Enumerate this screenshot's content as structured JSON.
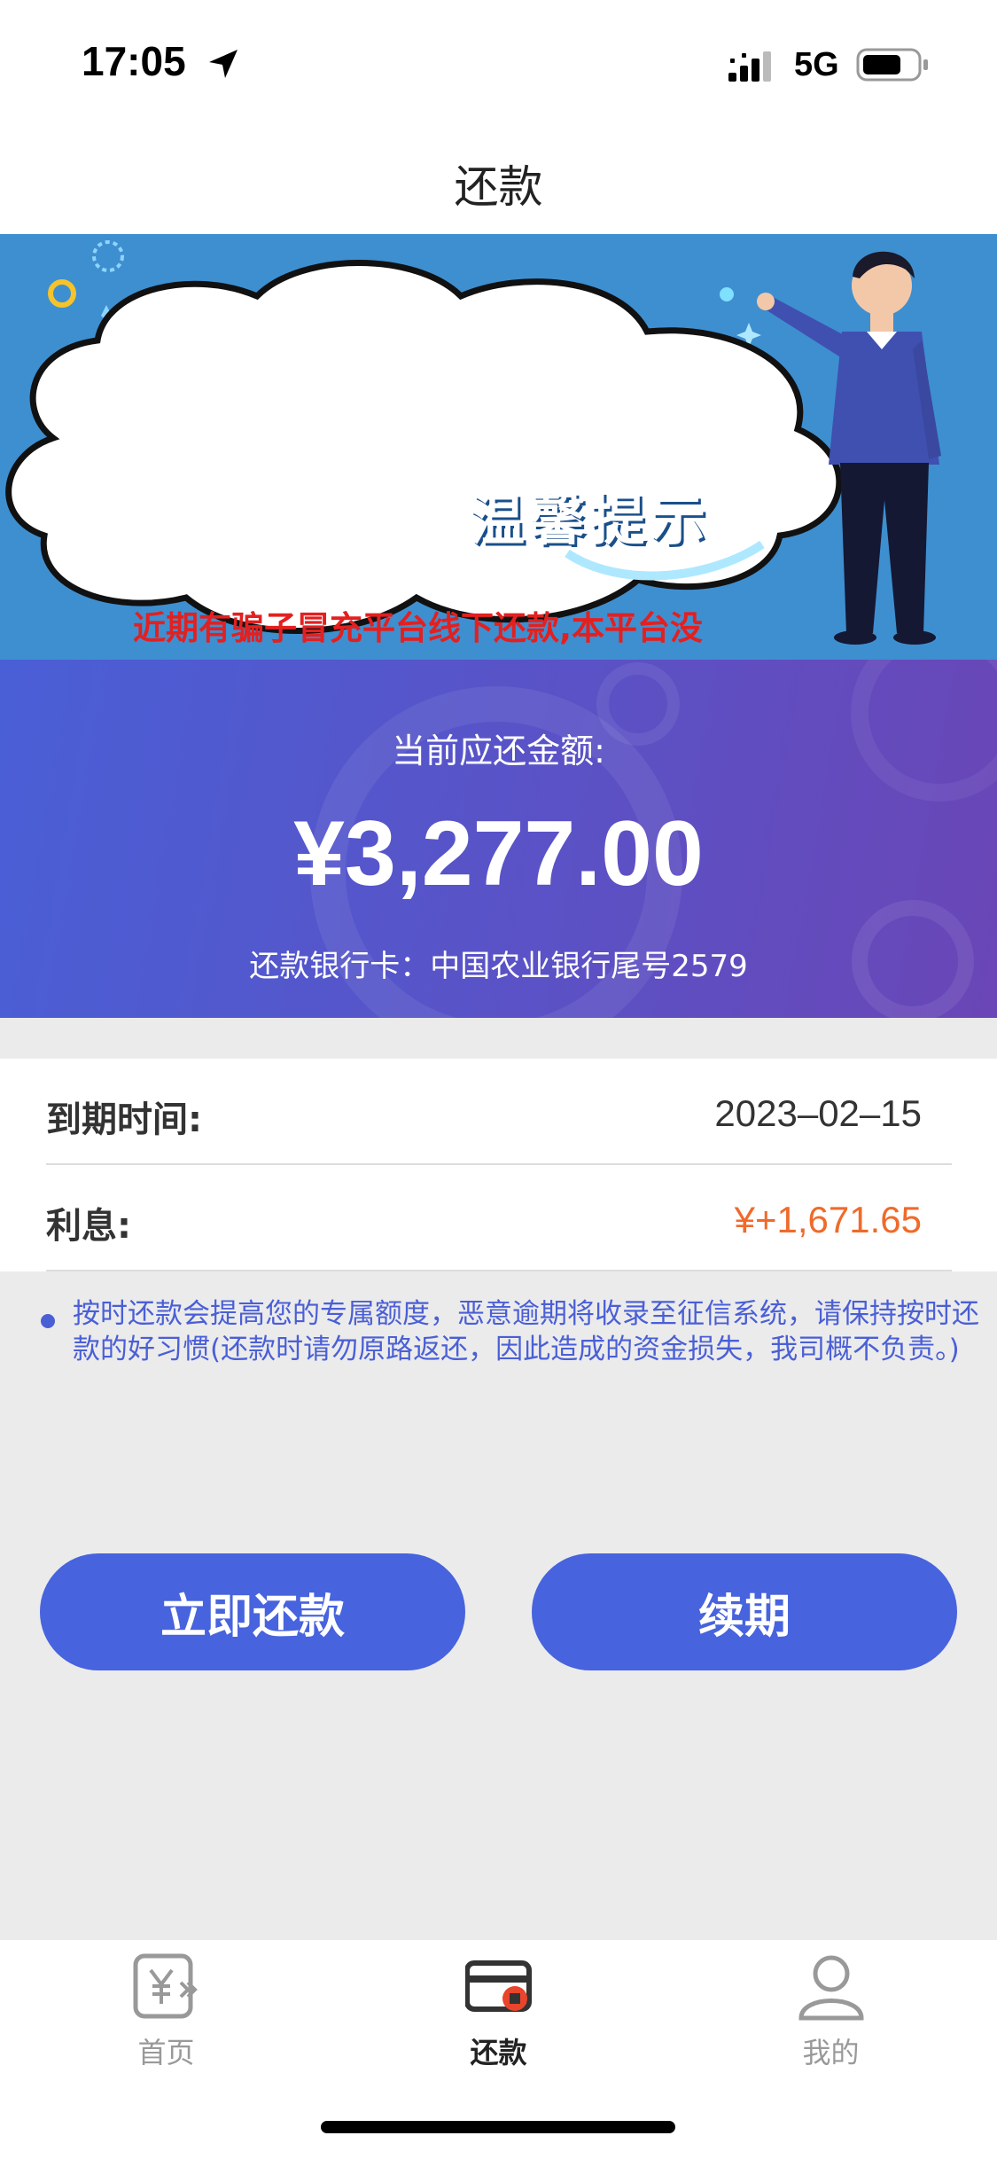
{
  "status_bar": {
    "time": "17:05",
    "network": "5G",
    "icons": [
      "location-arrow-icon",
      "signal-icon",
      "battery-icon"
    ]
  },
  "nav": {
    "title": "还款"
  },
  "banner": {
    "title": "温馨提示",
    "message": "近期有骗子冒充平台线下还款,本平台没有\"微信公众号\",也不会主动添加QQ,要求线下还款这些都是骗子.还款请线上处理"
  },
  "amount_card": {
    "label": "当前应还金额:",
    "amount": "¥3,277.00",
    "bank_card": "还款银行卡：中国农业银行尾号2579"
  },
  "details": {
    "due_label": "到期时间:",
    "due_value": "2023–02–15",
    "interest_label": "利息:",
    "interest_value": "¥+1,671.65"
  },
  "notice": {
    "text": "按时还款会提高您的专属额度，恶意逾期将收录至征信系统，请保持按时还款的好习惯(还款时请勿原路返还，因此造成的资金损失，我司概不负责。)"
  },
  "buttons": {
    "repay_now": "立即还款",
    "renew": "续期"
  },
  "tab_bar": {
    "tabs": [
      {
        "label": "首页",
        "icon": "yuan-home-icon",
        "active": false
      },
      {
        "label": "还款",
        "icon": "card-icon",
        "active": true
      },
      {
        "label": "我的",
        "icon": "user-icon",
        "active": false
      }
    ]
  },
  "colors": {
    "accent": "#4763dd",
    "interest": "#f06a2a",
    "warning_text": "#e32020",
    "banner_bg": "#3e8fd0"
  }
}
